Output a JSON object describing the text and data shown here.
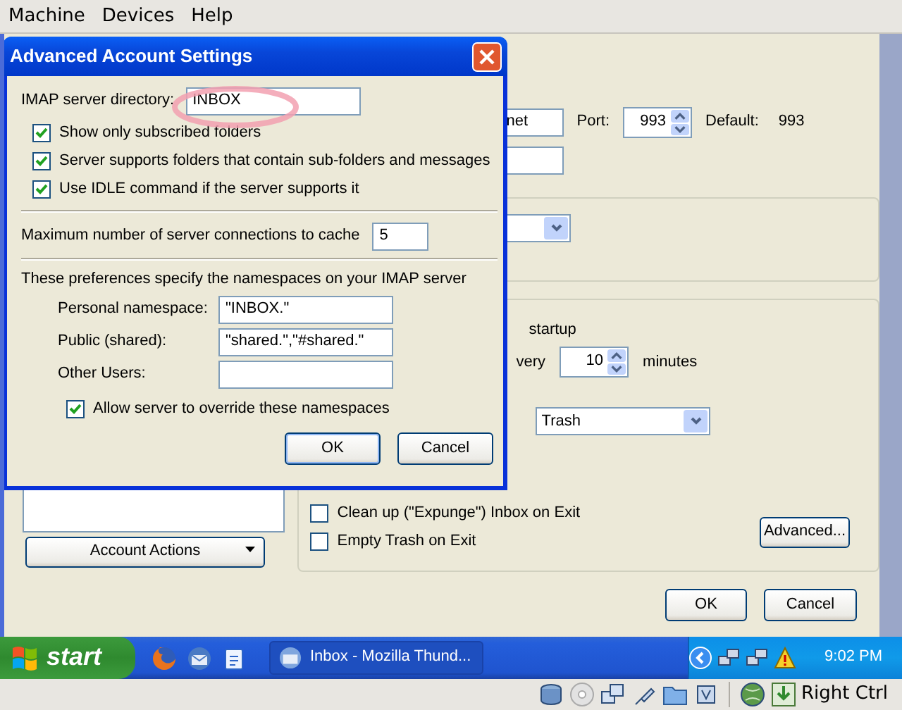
{
  "vm_menu": [
    {
      "label": "Machine"
    },
    {
      "label": "Devices"
    },
    {
      "label": "Help"
    }
  ],
  "dialog": {
    "title": "Advanced Account Settings",
    "imap_directory": {
      "label": "IMAP server directory:",
      "value": "INBOX"
    },
    "options": [
      {
        "label": "Show only subscribed folders",
        "checked": true
      },
      {
        "label": "Server supports folders that contain sub-folders and messages",
        "checked": true
      },
      {
        "label": "Use IDLE command if the server supports it",
        "checked": true
      }
    ],
    "max_connections": {
      "label": "Maximum number of server connections to cache",
      "value": "5"
    },
    "namespaces": {
      "intro": "These preferences specify the namespaces on your IMAP server",
      "fields": [
        {
          "label": "Personal namespace:",
          "value": "\"INBOX.\""
        },
        {
          "label": "Public (shared):",
          "value": "\"shared.\",\"#shared.\""
        },
        {
          "label": "Other Users:"
        }
      ]
    },
    "override": {
      "label": "Allow server to override these namespaces",
      "checked": true
    },
    "buttons": [
      {
        "label": "OK",
        "default": true
      },
      {
        "label": "Cancel",
        "default": false
      }
    ]
  },
  "account_settings": {
    "server_value": "net",
    "port_label": "Port:",
    "port_value": "993",
    "default_label": "Default:",
    "default_value": "993",
    "startup_text": "startup",
    "check_every_label": "very",
    "check_every_value": "10",
    "minutes_label": "minutes",
    "trash_folder": "Trash",
    "exit_options": [
      {
        "label": "Clean up (\"Expunge\") Inbox on Exit",
        "checked": false
      },
      {
        "label": "Empty Trash on Exit",
        "checked": false
      }
    ],
    "advanced_button": {
      "label": "Advanced..."
    },
    "account_actions": {
      "label": "Account Actions"
    },
    "buttons": [
      {
        "label": "OK",
        "default": false
      },
      {
        "label": "Cancel",
        "default": false
      }
    ]
  },
  "taskbar": {
    "start": "start",
    "tasks": [
      {
        "label": "Inbox - Mozilla Thund...",
        "selected": false
      }
    ],
    "clock": "9:02 PM"
  },
  "vm_status": {
    "host_key": "Right Ctrl"
  }
}
